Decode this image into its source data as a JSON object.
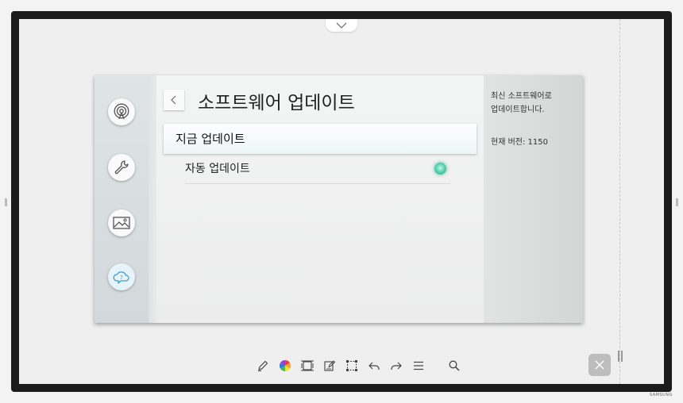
{
  "window": {
    "title": "소프트웨어 업데이트"
  },
  "sidebar": {
    "items": [
      {
        "icon": "broadcast-icon"
      },
      {
        "icon": "wrench-icon"
      },
      {
        "icon": "image-icon"
      },
      {
        "icon": "help-cloud-icon",
        "active": true
      }
    ]
  },
  "menu": {
    "update_now": "지금 업데이트",
    "auto_update": "자동 업데이트",
    "auto_update_on": true
  },
  "info": {
    "line1": "최신 소프트웨어로",
    "line2": "업데이트합니다.",
    "version": "현재 버전: 1150"
  },
  "toolbar": {
    "icons": [
      "pen-icon",
      "color-wheel-icon",
      "layout-icon",
      "edit-note-icon",
      "select-rect-icon",
      "undo-icon",
      "redo-icon",
      "menu-icon",
      "search-icon"
    ]
  },
  "brand": "SAMSUNG",
  "colors": {
    "accent": "#3cc7a3",
    "close_button": "#bdbdbd"
  }
}
